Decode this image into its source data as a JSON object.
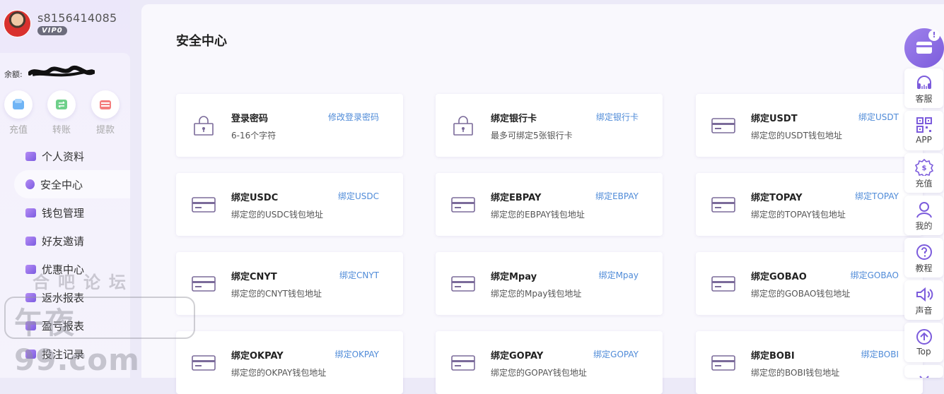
{
  "profile": {
    "username": "s8156414085",
    "vip": "VIP0"
  },
  "balance": {
    "label": "余额:"
  },
  "quick_actions": [
    {
      "label": "充值",
      "icon": "deposit-icon"
    },
    {
      "label": "转账",
      "icon": "transfer-icon"
    },
    {
      "label": "提款",
      "icon": "withdraw-icon"
    }
  ],
  "menu": [
    {
      "label": "个人资料",
      "icon": "profile-icon"
    },
    {
      "label": "安全中心",
      "icon": "shield-icon",
      "active": true
    },
    {
      "label": "钱包管理",
      "icon": "wallet-icon"
    },
    {
      "label": "好友邀请",
      "icon": "invite-icon"
    },
    {
      "label": "优惠中心",
      "icon": "promo-icon"
    },
    {
      "label": "返水报表",
      "icon": "report-icon"
    },
    {
      "label": "盈亏报表",
      "icon": "report-icon"
    },
    {
      "label": "投注记录",
      "icon": "record-icon"
    }
  ],
  "watermark": {
    "top": "合吧论坛",
    "main": "午夜99.com"
  },
  "page_title": "安全中心",
  "cards": [
    {
      "title": "登录密码",
      "desc": "6-16个字符",
      "link": "修改登录密码",
      "icon": "lock-icon"
    },
    {
      "title": "绑定银行卡",
      "desc": "最多可绑定5张银行卡",
      "link": "绑定银行卡",
      "icon": "lock-icon"
    },
    {
      "title": "绑定USDT",
      "desc": "绑定您的USDT钱包地址",
      "link": "绑定USDT",
      "icon": "card-icon"
    },
    {
      "title": "绑定USDC",
      "desc": "绑定您的USDC钱包地址",
      "link": "绑定USDC",
      "icon": "card-icon"
    },
    {
      "title": "绑定EBPAY",
      "desc": "绑定您的EBPAY钱包地址",
      "link": "绑定EBPAY",
      "icon": "card-icon"
    },
    {
      "title": "绑定TOPAY",
      "desc": "绑定您的TOPAY钱包地址",
      "link": "绑定TOPAY",
      "icon": "card-icon"
    },
    {
      "title": "绑定CNYT",
      "desc": "绑定您的CNYT钱包地址",
      "link": "绑定CNYT",
      "icon": "card-icon"
    },
    {
      "title": "绑定Mpay",
      "desc": "绑定您的Mpay钱包地址",
      "link": "绑定Mpay",
      "icon": "card-icon"
    },
    {
      "title": "绑定GOBAO",
      "desc": "绑定您的GOBAO钱包地址",
      "link": "绑定GOBAO",
      "icon": "card-icon"
    },
    {
      "title": "绑定OKPAY",
      "desc": "绑定您的OKPAY钱包地址",
      "link": "绑定OKPAY",
      "icon": "card-icon"
    },
    {
      "title": "绑定GOPAY",
      "desc": "绑定您的GOPAY钱包地址",
      "link": "绑定GOPAY",
      "icon": "card-icon"
    },
    {
      "title": "绑定BOBI",
      "desc": "绑定您的BOBI钱包地址",
      "link": "绑定BOBI",
      "icon": "card-icon"
    }
  ],
  "float_bar": {
    "badge": "!",
    "items": [
      {
        "label": "客服",
        "icon": "headset-icon"
      },
      {
        "label": "APP",
        "icon": "qrcode-icon"
      },
      {
        "label": "充值",
        "icon": "deposit-gear-icon"
      },
      {
        "label": "我的",
        "icon": "user-icon"
      },
      {
        "label": "教程",
        "icon": "help-icon"
      },
      {
        "label": "声音",
        "icon": "speaker-icon"
      },
      {
        "label": "Top",
        "icon": "arrow-up-icon"
      }
    ]
  },
  "colors": {
    "accent": "#7c5cdc",
    "link": "#4f8bd8"
  }
}
